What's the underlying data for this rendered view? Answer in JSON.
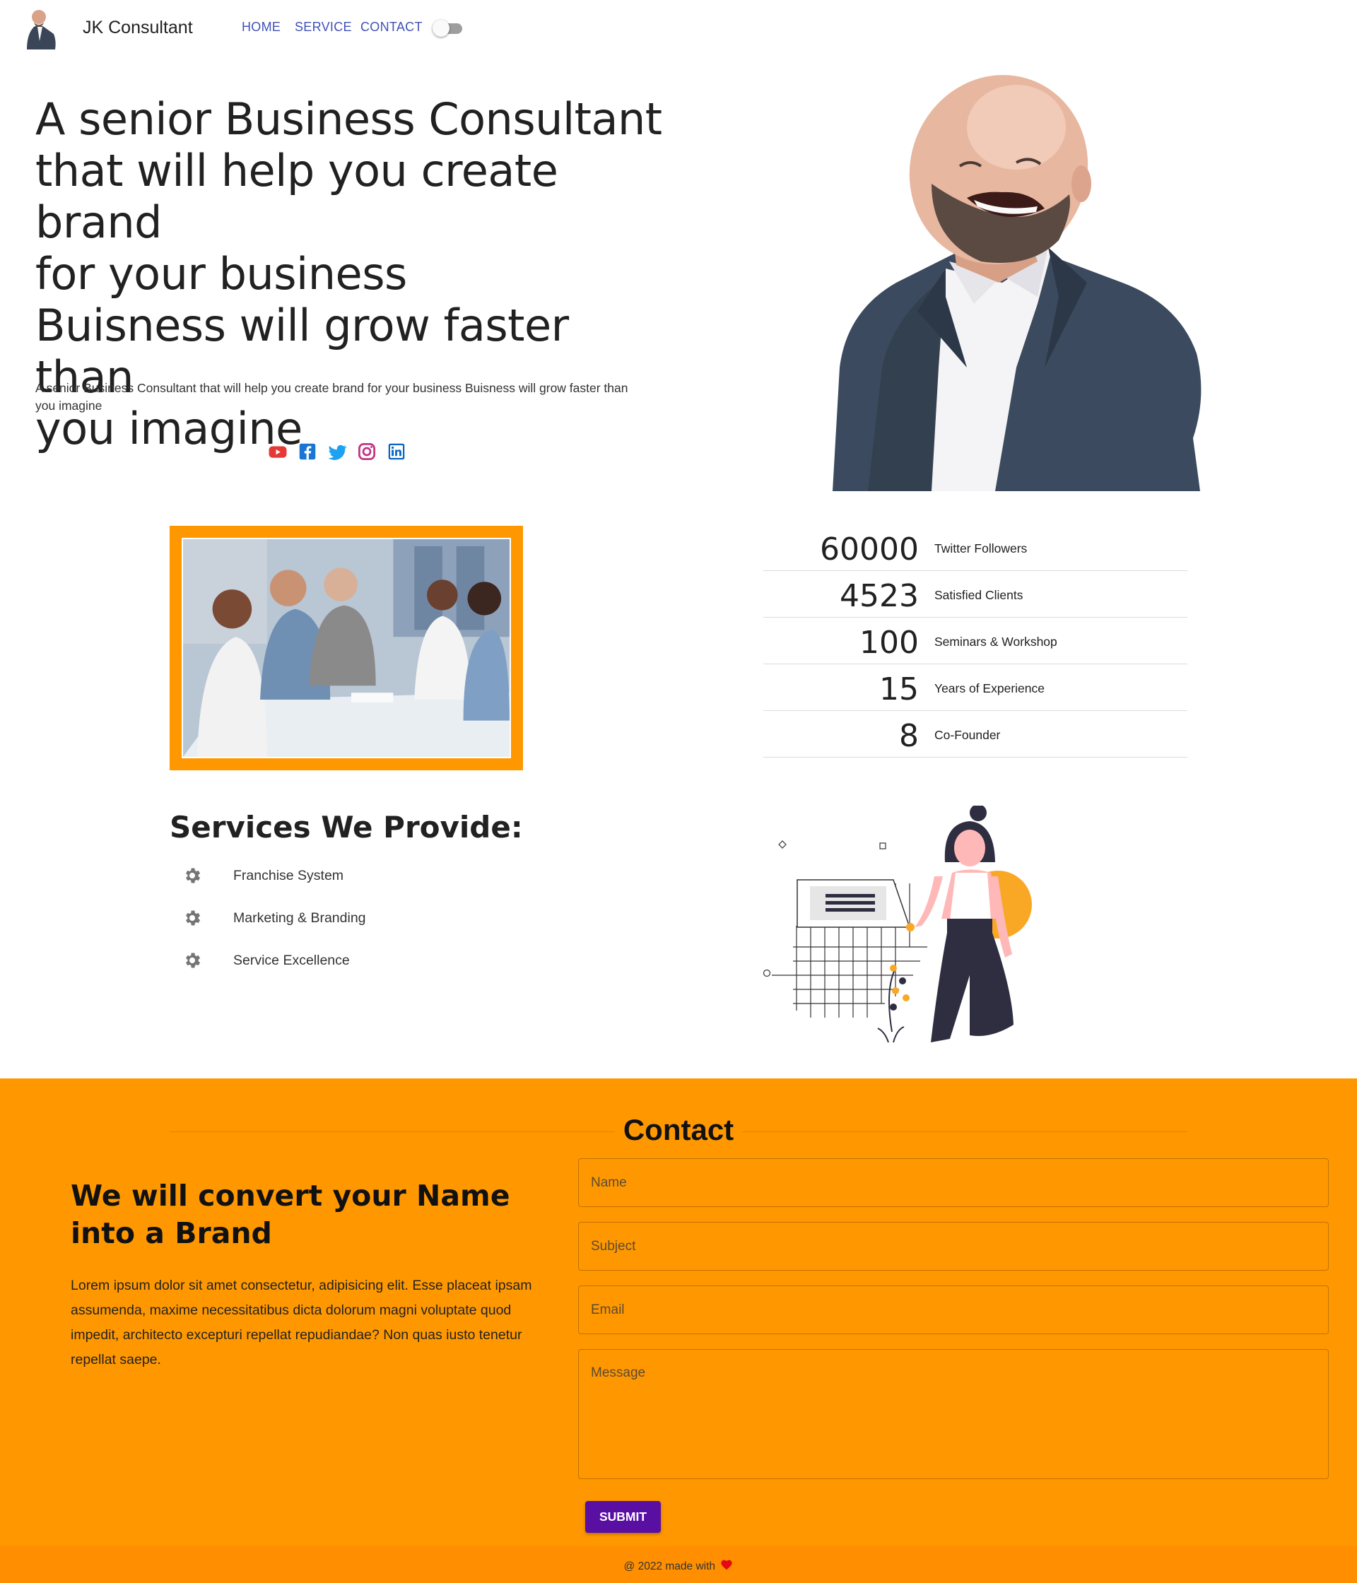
{
  "nav": {
    "brand": "JK Consultant",
    "links": [
      "HOME",
      "SERVICE",
      "CONTACT"
    ],
    "theme_toggle": "off"
  },
  "hero": {
    "headline_lines": [
      "A senior Business Consultant",
      "that will help you create brand",
      "for your business",
      "Buisness will grow faster than",
      "you imagine"
    ],
    "subtitle": "A senior Business Consultant that will help you create brand for your business Buisness will grow faster than you imagine",
    "social_icons": [
      "youtube-icon",
      "facebook-icon",
      "twitter-icon",
      "instagram-icon",
      "linkedin-icon"
    ],
    "social_colors": [
      "#e53935",
      "#1976d2",
      "#1da1f2",
      "#c13584",
      "#0a66c2"
    ]
  },
  "stats": [
    {
      "number": "60000",
      "label": "Twitter Followers"
    },
    {
      "number": "4523",
      "label": "Satisfied Clients"
    },
    {
      "number": "100",
      "label": "Seminars & Workshop"
    },
    {
      "number": "15",
      "label": "Years of Experience"
    },
    {
      "number": "8",
      "label": "Co-Founder"
    }
  ],
  "services": {
    "title": "Services We Provide:",
    "items": [
      "Franchise System",
      "Marketing & Branding",
      "Service Excellence"
    ],
    "icon": "gear-icon"
  },
  "contact": {
    "title": "Contact",
    "heading": "We will convert your Name into a Brand",
    "body": "Lorem ipsum dolor sit amet consectetur, adipisicing elit. Esse placeat ipsam assumenda, maxime necessitatibus dicta dolorum magni voluptate quod impedit, architecto excepturi repellat repudiandae? Non quas iusto tenetur repellat saepe.",
    "placeholders": {
      "name": "Name",
      "subject": "Subject",
      "email": "Email",
      "message": "Message"
    },
    "submit_label": "SUBMIT"
  },
  "footer": {
    "text": "@ 2022 made with",
    "icon": "heart-icon"
  },
  "colors": {
    "accent_orange": "#ff9800",
    "footer_orange": "#ff8f00",
    "nav_link": "#3f51b5",
    "submit": "#5a0fa3",
    "heart": "#e50914"
  }
}
